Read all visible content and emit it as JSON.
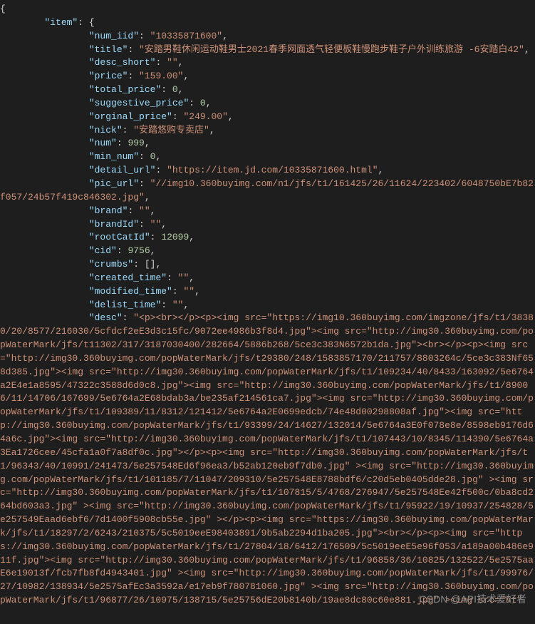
{
  "indent_root": "",
  "indent_item": "        ",
  "indent_field": "                ",
  "item_label": "item",
  "fields": {
    "num_iid": "10335871600",
    "title": "安踏男鞋休闲运动鞋男士2021春季网面透气轻便板鞋慢跑步鞋子户外训练旅游 -6安踏白42",
    "desc_short": "",
    "price": "159.00",
    "total_price": 0,
    "suggestive_price": 0,
    "orginal_price": "249.00",
    "nick": "安踏悠购专卖店",
    "num": 999,
    "min_num": 0,
    "detail_url": "https://item.jd.com/10335871600.html",
    "pic_url": "//img10.360buyimg.com/n1/jfs/t1/161425/26/11624/223402/6048750bE7b82f057/24b57f419c846302.jpg",
    "brand": "",
    "brandId": "",
    "rootCatId": 12099,
    "cid": 9756,
    "crumbs": [],
    "created_time": "",
    "modified_time": "",
    "delist_time": "",
    "desc": "<p><br></p><p><img src=\"https://img10.360buyimg.com/imgzone/jfs/t1/38380/20/8577/216030/5cfdcf2eE3d3c15fc/9072ee4986b3f8d4.jpg\"><img src=\"http://img30.360buyimg.com/popWaterMark/jfs/t11302/317/3187030400/282664/5886b268/5ce3c383N6572b1da.jpg\"><br></p><p><img src=\"http://img30.360buyimg.com/popWaterMark/jfs/t29380/248/1583857170/211757/8803264c/5ce3c383Nf658d385.jpg\"><img src=\"http://img30.360buyimg.com/popWaterMark/jfs/t1/109234/40/8433/163092/5e6764a2E4e1a8595/47322c3588d6d0c8.jpg\"><img src=\"http://img30.360buyimg.com/popWaterMark/jfs/t1/89006/11/14706/167699/5e6764a2E68bdab3a/be235af214561ca7.jpg\"><img src=\"http://img30.360buyimg.com/popWaterMark/jfs/t1/109389/11/8312/121412/5e6764a2E0699edcb/74e48d00298808af.jpg\"><img src=\"http://img30.360buyimg.com/popWaterMark/jfs/t1/93399/24/14627/132014/5e6764a3E0f078e8e/8598eb9176d64a6c.jpg\"><img src=\"http://img30.360buyimg.com/popWaterMark/jfs/t1/107443/10/8345/114390/5e6764a3Ea1726cee/45cfa1a0f7a8df0c.jpg\"></p><p><img src=\"http://img30.360buyimg.com/popWaterMark/jfs/t1/96343/40/10991/241473/5e257548Ed6f96ea3/b52ab120eb9f7db0.jpg\" ><img src=\"http://img30.360buyimg.com/popWaterMark/jfs/t1/101185/7/11047/209310/5e257548E8788bdf6/c20d5eb0405dde28.jpg\" ><img src=\"http://img30.360buyimg.com/popWaterMark/jfs/t1/107815/5/4768/276947/5e257548Ee42f500c/0ba8cd264bd603a3.jpg\" ><img src=\"http://img30.360buyimg.com/popWaterMark/jfs/t1/95922/19/10937/254828/5e257549Eaad6ebf6/7d1400f5908cb55e.jpg\" ></p><p><img src=\"https://img30.360buyimg.com/popWaterMark/jfs/t1/18297/2/6243/210375/5c5019eeE98403891/9b5ab2294d1ba205.jpg\"><br></p><p><img src=\"https://img30.360buyimg.com/popWaterMark/jfs/t1/27804/18/6412/176509/5c5019eeE5e96f053/a189a00b486e911f.jpg\"><img src=\"http://img30.360buyimg.com/popWaterMark/jfs/t1/96858/36/10825/132522/5e2575aaE6e19013f/fcb7fb8fd4943401.jpg\" ><img src=\"http://img30.360buyimg.com/popWaterMark/jfs/t1/99976/27/10982/138934/5e2575afEc3a3592a/e17eb9f780781060.jpg\" ><img src=\"http://img30.360buyimg.com/popWaterMark/jfs/t1/96877/26/10975/138715/5e25756dE20b8140b/19ae8dc80c60e881.jpg\" ><img src=\"ht"
  },
  "field_order": [
    "num_iid",
    "title",
    "desc_short",
    "price",
    "total_price",
    "suggestive_price",
    "orginal_price",
    "nick",
    "num",
    "min_num",
    "detail_url",
    "pic_url",
    "brand",
    "brandId",
    "rootCatId",
    "cid",
    "crumbs",
    "created_time",
    "modified_time",
    "delist_time",
    "desc"
  ],
  "watermark": "CSDN @API技术爱好者"
}
